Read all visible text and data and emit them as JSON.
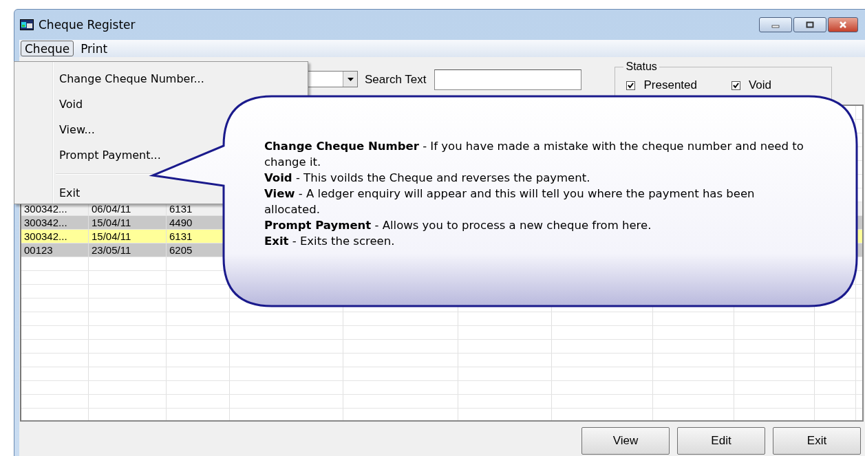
{
  "window": {
    "title": "Cheque Register"
  },
  "menu_bar": [
    {
      "label": "Cheque",
      "selected": true
    },
    {
      "label": "Print",
      "selected": false
    }
  ],
  "menu": {
    "items": [
      {
        "label": "Change Cheque Number...",
        "kind": "item"
      },
      {
        "label": "Void",
        "kind": "item"
      },
      {
        "label": "View...",
        "kind": "item"
      },
      {
        "label": "Prompt Payment...",
        "kind": "item"
      },
      {
        "kind": "separator"
      },
      {
        "label": "Exit",
        "kind": "item"
      }
    ]
  },
  "search": {
    "label": "Search Text"
  },
  "status": {
    "title": "Status",
    "options": [
      {
        "label": "Presented",
        "checked": true
      },
      {
        "label": "Void",
        "checked": true
      }
    ]
  },
  "table": {
    "rows": [
      {
        "cells": [
          "300342...",
          "06/04/11",
          "6131"
        ],
        "color": "#f0f0f0"
      },
      {
        "cells": [
          "300342...",
          "15/04/11",
          "4490"
        ],
        "color": "#c8c8c8"
      },
      {
        "cells": [
          "300342...",
          "15/04/11",
          "6131"
        ],
        "color": "#ffff99"
      },
      {
        "cells": [
          "00123",
          "23/05/11",
          "6205"
        ],
        "color": "#c8c8c8"
      }
    ]
  },
  "buttons": [
    {
      "label": "View"
    },
    {
      "label": "Edit"
    },
    {
      "label": "Exit"
    }
  ],
  "callout": {
    "lines": [
      "**Change Cheque Number** - If you have made a mistake with the cheque number and need to change it.",
      "**Void** - This voilds the Cheque and reverses the payment.",
      "**View** - A ledger enquiry will appear and this will tell you where the payment has been allocated.",
      "**Prompt Payment** - Allows you to process a new cheque from here.",
      "**Exit** - Exits the screen."
    ]
  }
}
